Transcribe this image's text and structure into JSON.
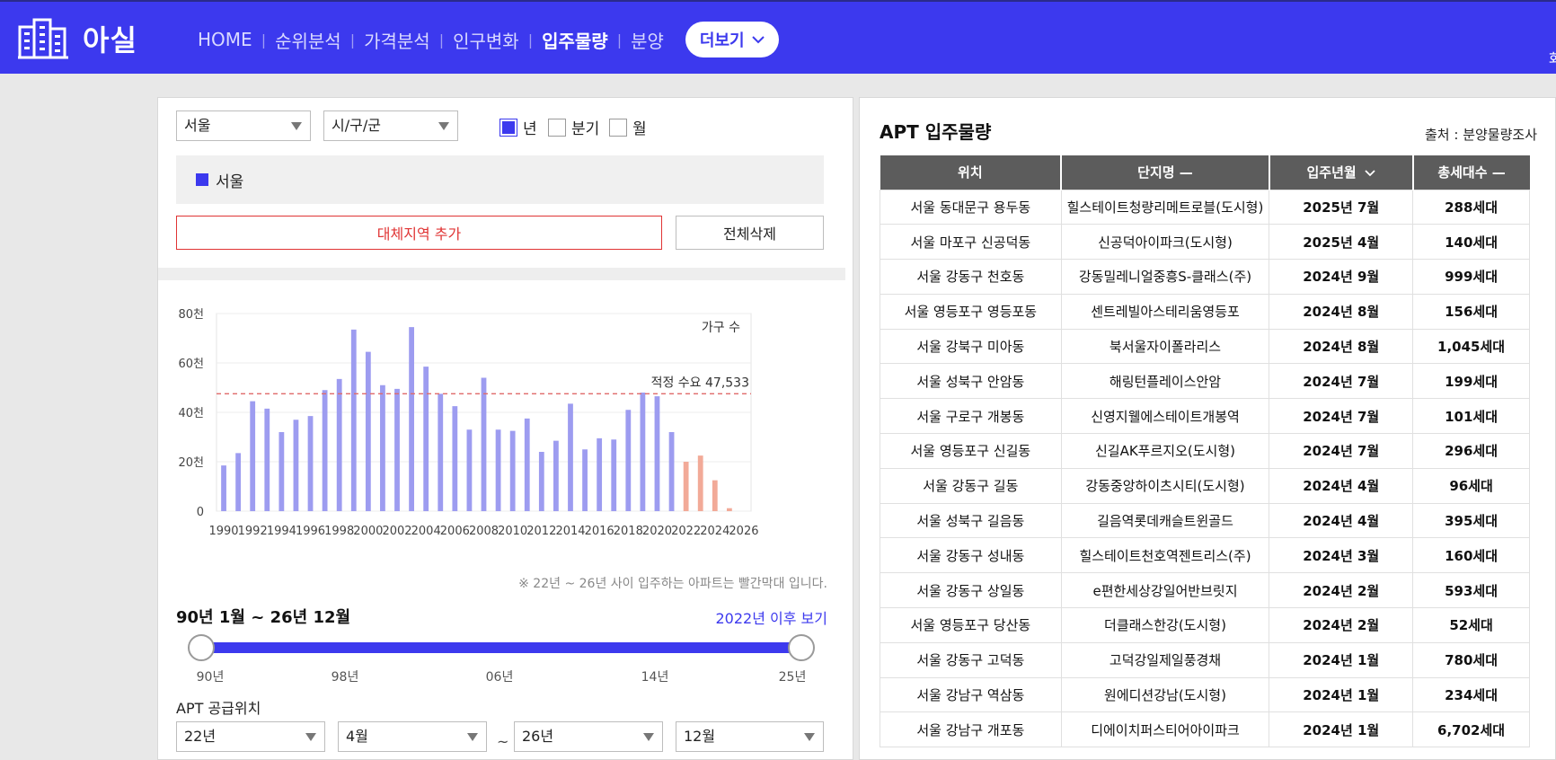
{
  "header": {
    "logo_text": "아실",
    "nav": [
      "HOME",
      "순위분석",
      "가격분석",
      "인구변화",
      "입주물량",
      "분양"
    ],
    "active_index": 4,
    "more_label": "더보기",
    "edge_text": "화"
  },
  "filters": {
    "region": "서울",
    "district": "시/구/군",
    "period_options": [
      {
        "label": "년",
        "checked": true
      },
      {
        "label": "분기",
        "checked": false
      },
      {
        "label": "월",
        "checked": false
      }
    ]
  },
  "selected_region": "서울",
  "buttons": {
    "add": "대체지역 추가",
    "clear": "전체삭제"
  },
  "chart_data": {
    "type": "bar",
    "y_unit_label": "가구 수",
    "y_ticks": [
      "0",
      "20천",
      "40천",
      "60천",
      "80천"
    ],
    "ylim": [
      0,
      80000
    ],
    "x_tick_labels": [
      "1990",
      "1992",
      "1994",
      "1996",
      "1998",
      "2000",
      "2002",
      "2004",
      "2006",
      "2008",
      "2010",
      "2012",
      "2014",
      "2016",
      "2018",
      "2020",
      "2022",
      "2024",
      "2026"
    ],
    "categories": [
      1990,
      1991,
      1992,
      1993,
      1994,
      1995,
      1996,
      1997,
      1998,
      1999,
      2000,
      2001,
      2002,
      2003,
      2004,
      2005,
      2006,
      2007,
      2008,
      2009,
      2010,
      2011,
      2012,
      2013,
      2014,
      2015,
      2016,
      2017,
      2018,
      2019,
      2020,
      2021,
      2022,
      2023,
      2024,
      2025,
      2026
    ],
    "values": [
      18500,
      23500,
      44500,
      41500,
      32000,
      37000,
      38500,
      49000,
      53500,
      73500,
      64500,
      51000,
      49500,
      74500,
      58500,
      47500,
      42500,
      33000,
      54000,
      33000,
      32500,
      37500,
      24000,
      28500,
      43500,
      25000,
      29500,
      29000,
      41000,
      48000,
      46500,
      32000,
      20000,
      22500,
      12500,
      1200,
      0
    ],
    "highlight_from": 2022,
    "colors": {
      "normal": "#9d9cf0",
      "highlight": "#f2aa98",
      "reference": "#e06a6a"
    },
    "reference_line": {
      "value": 47533,
      "label": "적정 수요 47,533"
    },
    "grid": true
  },
  "chart_note": "※ 22년 ~ 26년 사이 입주하는 아파트는 빨간막대 입니다.",
  "range": {
    "label": "90년 1월 ~ 26년 12월",
    "after_link": "2022년 이후 보기",
    "slider_start": 0,
    "slider_end": 1,
    "ticks": [
      "90년",
      "98년",
      "06년",
      "14년",
      "25년"
    ]
  },
  "supply": {
    "label": "APT 공급위치",
    "from_year": "22년",
    "from_month": "4월",
    "to_year": "26년",
    "to_month": "12월",
    "tilde": "~"
  },
  "right": {
    "title": "APT 입주물량",
    "source": "출처 : 분양물량조사",
    "columns": [
      "위치",
      "단지명 —",
      "입주년월",
      "총세대수 —"
    ],
    "rows": [
      [
        "서울 동대문구 용두동",
        "힐스테이트청량리메트로블(도시형)",
        "2025년 7월",
        "288세대"
      ],
      [
        "서울 마포구 신공덕동",
        "신공덕아이파크(도시형)",
        "2025년 4월",
        "140세대"
      ],
      [
        "서울 강동구 천호동",
        "강동밀레니얼중흥S-클래스(주)",
        "2024년 9월",
        "999세대"
      ],
      [
        "서울 영등포구 영등포동",
        "센트레빌아스테리움영등포",
        "2024년 8월",
        "156세대"
      ],
      [
        "서울 강북구 미아동",
        "북서울자이폴라리스",
        "2024년 8월",
        "1,045세대"
      ],
      [
        "서울 성북구 안암동",
        "해링턴플레이스안암",
        "2024년 7월",
        "199세대"
      ],
      [
        "서울 구로구 개봉동",
        "신영지웰에스테이트개봉역",
        "2024년 7월",
        "101세대"
      ],
      [
        "서울 영등포구 신길동",
        "신길AK푸르지오(도시형)",
        "2024년 7월",
        "296세대"
      ],
      [
        "서울 강동구 길동",
        "강동중앙하이츠시티(도시형)",
        "2024년 4월",
        "96세대"
      ],
      [
        "서울 성북구 길음동",
        "길음역롯데캐슬트윈골드",
        "2024년 4월",
        "395세대"
      ],
      [
        "서울 강동구 성내동",
        "힐스테이트천호역젠트리스(주)",
        "2024년 3월",
        "160세대"
      ],
      [
        "서울 강동구 상일동",
        "e편한세상강일어반브릿지",
        "2024년 2월",
        "593세대"
      ],
      [
        "서울 영등포구 당산동",
        "더클래스한강(도시형)",
        "2024년 2월",
        "52세대"
      ],
      [
        "서울 강동구 고덕동",
        "고덕강일제일풍경채",
        "2024년 1월",
        "780세대"
      ],
      [
        "서울 강남구 역삼동",
        "원에디션강남(도시형)",
        "2024년 1월",
        "234세대"
      ],
      [
        "서울 강남구 개포동",
        "디에이치퍼스티어아이파크",
        "2024년 1월",
        "6,702세대"
      ]
    ]
  }
}
